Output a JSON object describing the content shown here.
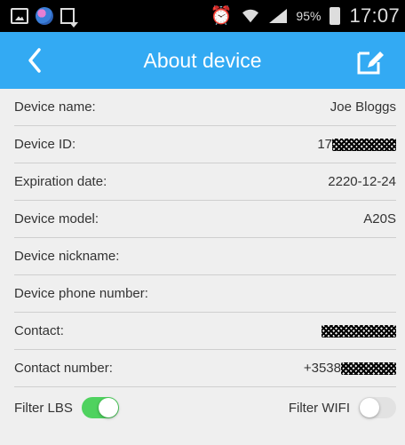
{
  "status_bar": {
    "battery_percent": "95%",
    "time": "17:07",
    "icons": [
      "gallery-icon",
      "browser-globe-icon",
      "download-icon",
      "alarm-icon",
      "wifi-icon",
      "signal-icon",
      "battery-charging-icon"
    ]
  },
  "header": {
    "title": "About device",
    "back_icon": "chevron-left-icon",
    "edit_icon": "edit-icon",
    "background_color": "#33aaf3"
  },
  "rows": [
    {
      "label": "Device name:",
      "value": "Joe Bloggs"
    },
    {
      "label": "Device ID:",
      "value_prefix": "17",
      "redacted": true
    },
    {
      "label": "Expiration date:",
      "value": "2220-12-24"
    },
    {
      "label": "Device model:",
      "value": "A20S"
    },
    {
      "label": "Device nickname:",
      "value": ""
    },
    {
      "label": "Device phone number:",
      "value": ""
    },
    {
      "label": "Contact:",
      "value_prefix": "",
      "redacted": true
    },
    {
      "label": "Contact number:",
      "value_prefix": "+3538",
      "redacted": true
    }
  ],
  "filters": {
    "lbs": {
      "label": "Filter LBS",
      "enabled": true
    },
    "wifi": {
      "label": "Filter WIFI",
      "enabled": false
    }
  },
  "colors": {
    "toggle_on": "#4fd25f",
    "toggle_off": "#e2e2e2"
  }
}
